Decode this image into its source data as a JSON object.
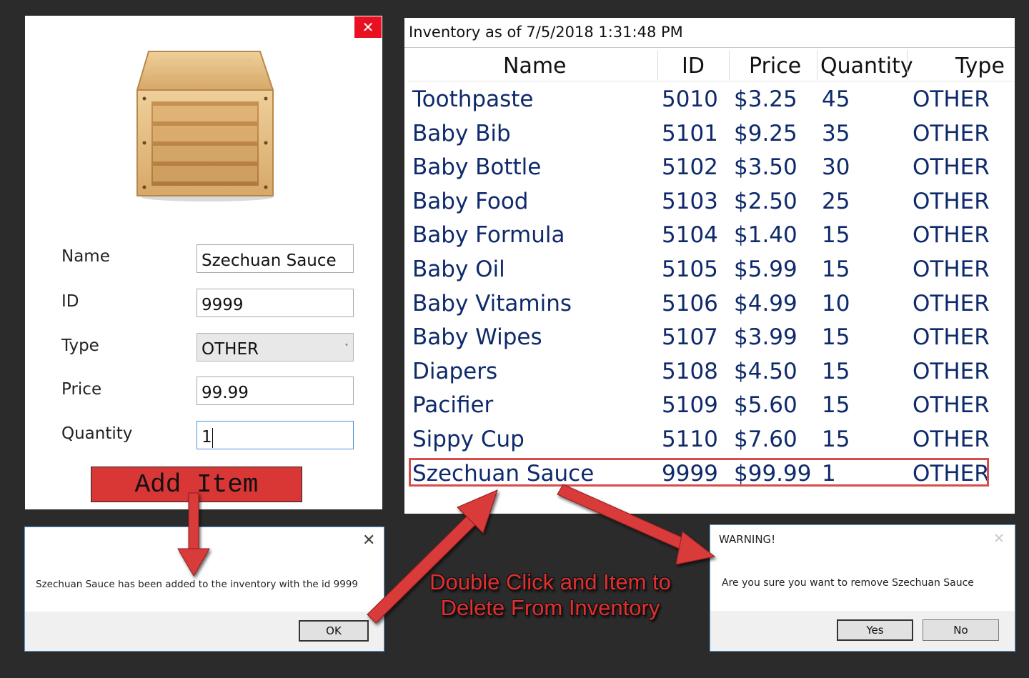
{
  "add_form": {
    "close_glyph": "✕",
    "image_icon": "wooden-crate-icon",
    "fields": {
      "name_label": "Name",
      "name_value": "Szechuan Sauce",
      "id_label": "ID",
      "id_value": "9999",
      "type_label": "Type",
      "type_value": "OTHER",
      "type_chevron": "˅",
      "price_label": "Price",
      "price_value": "99.99",
      "quantity_label": "Quantity",
      "quantity_value": "1"
    },
    "add_button_label": "Add Item",
    "add_button_color": "#d93636"
  },
  "inventory": {
    "title": "Inventory as of 7/5/2018 1:31:48 PM",
    "columns": [
      "Name",
      "ID",
      "Price",
      "Quantity",
      "Type"
    ],
    "rows": [
      [
        "Toothpaste",
        "5010",
        "$3.25",
        "45",
        "OTHER"
      ],
      [
        "Baby Bib",
        "5101",
        "$9.25",
        "35",
        "OTHER"
      ],
      [
        "Baby Bottle",
        "5102",
        "$3.50",
        "30",
        "OTHER"
      ],
      [
        "Baby Food",
        "5103",
        "$2.50",
        "25",
        "OTHER"
      ],
      [
        "Baby Formula",
        "5104",
        "$1.40",
        "15",
        "OTHER"
      ],
      [
        "Baby Oil",
        "5105",
        "$5.99",
        "15",
        "OTHER"
      ],
      [
        "Baby Vitamins",
        "5106",
        "$4.99",
        "10",
        "OTHER"
      ],
      [
        "Baby Wipes",
        "5107",
        "$3.99",
        "15",
        "OTHER"
      ],
      [
        "Diapers",
        "5108",
        "$4.50",
        "15",
        "OTHER"
      ],
      [
        "Pacifier",
        "5109",
        "$5.60",
        "15",
        "OTHER"
      ],
      [
        "Sippy Cup",
        "5110",
        "$7.60",
        "15",
        "OTHER"
      ],
      [
        "Szechuan Sauce",
        "9999",
        "$99.99",
        "1",
        "OTHER"
      ]
    ],
    "highlighted_row": 11,
    "text_color": "#0e2a6b"
  },
  "confirm_dialog": {
    "close_glyph": "✕",
    "message": "Szechuan Sauce has been added to the inventory with the id 9999",
    "ok_label": "OK"
  },
  "warning_dialog": {
    "title": "WARNING!",
    "close_glyph": "✕",
    "message": "Are you sure you want to remove Szechuan Sauce",
    "yes_label": "Yes",
    "no_label": "No"
  },
  "annotation": {
    "line1": "Double Click and Item to",
    "line2": "Delete From Inventory",
    "color": "#e03030"
  }
}
